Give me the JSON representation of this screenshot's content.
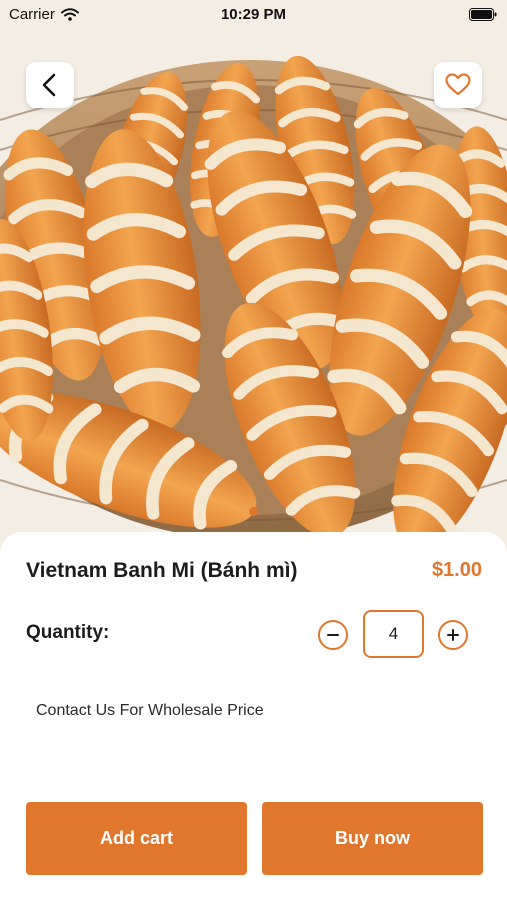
{
  "status_bar": {
    "carrier": "Carrier",
    "time": "10:29 PM"
  },
  "product": {
    "name": "Vietnam Banh Mi (Bánh mì)",
    "price": "$1.00",
    "image_icon": "bread-basket-photo"
  },
  "quantity": {
    "label": "Quantity:",
    "value": "4"
  },
  "note": "Contact Us For Wholesale Price",
  "actions": {
    "add_cart": "Add cart",
    "buy_now": "Buy now"
  },
  "colors": {
    "accent": "#e1772c",
    "text": "#1c1c1c",
    "background": "#ffffff"
  },
  "icons": {
    "back": "chevron-left-icon",
    "favorite": "heart-outline-icon",
    "minus": "minus-circle-icon",
    "plus": "plus-circle-icon",
    "wifi": "wifi-icon",
    "battery": "battery-icon"
  }
}
